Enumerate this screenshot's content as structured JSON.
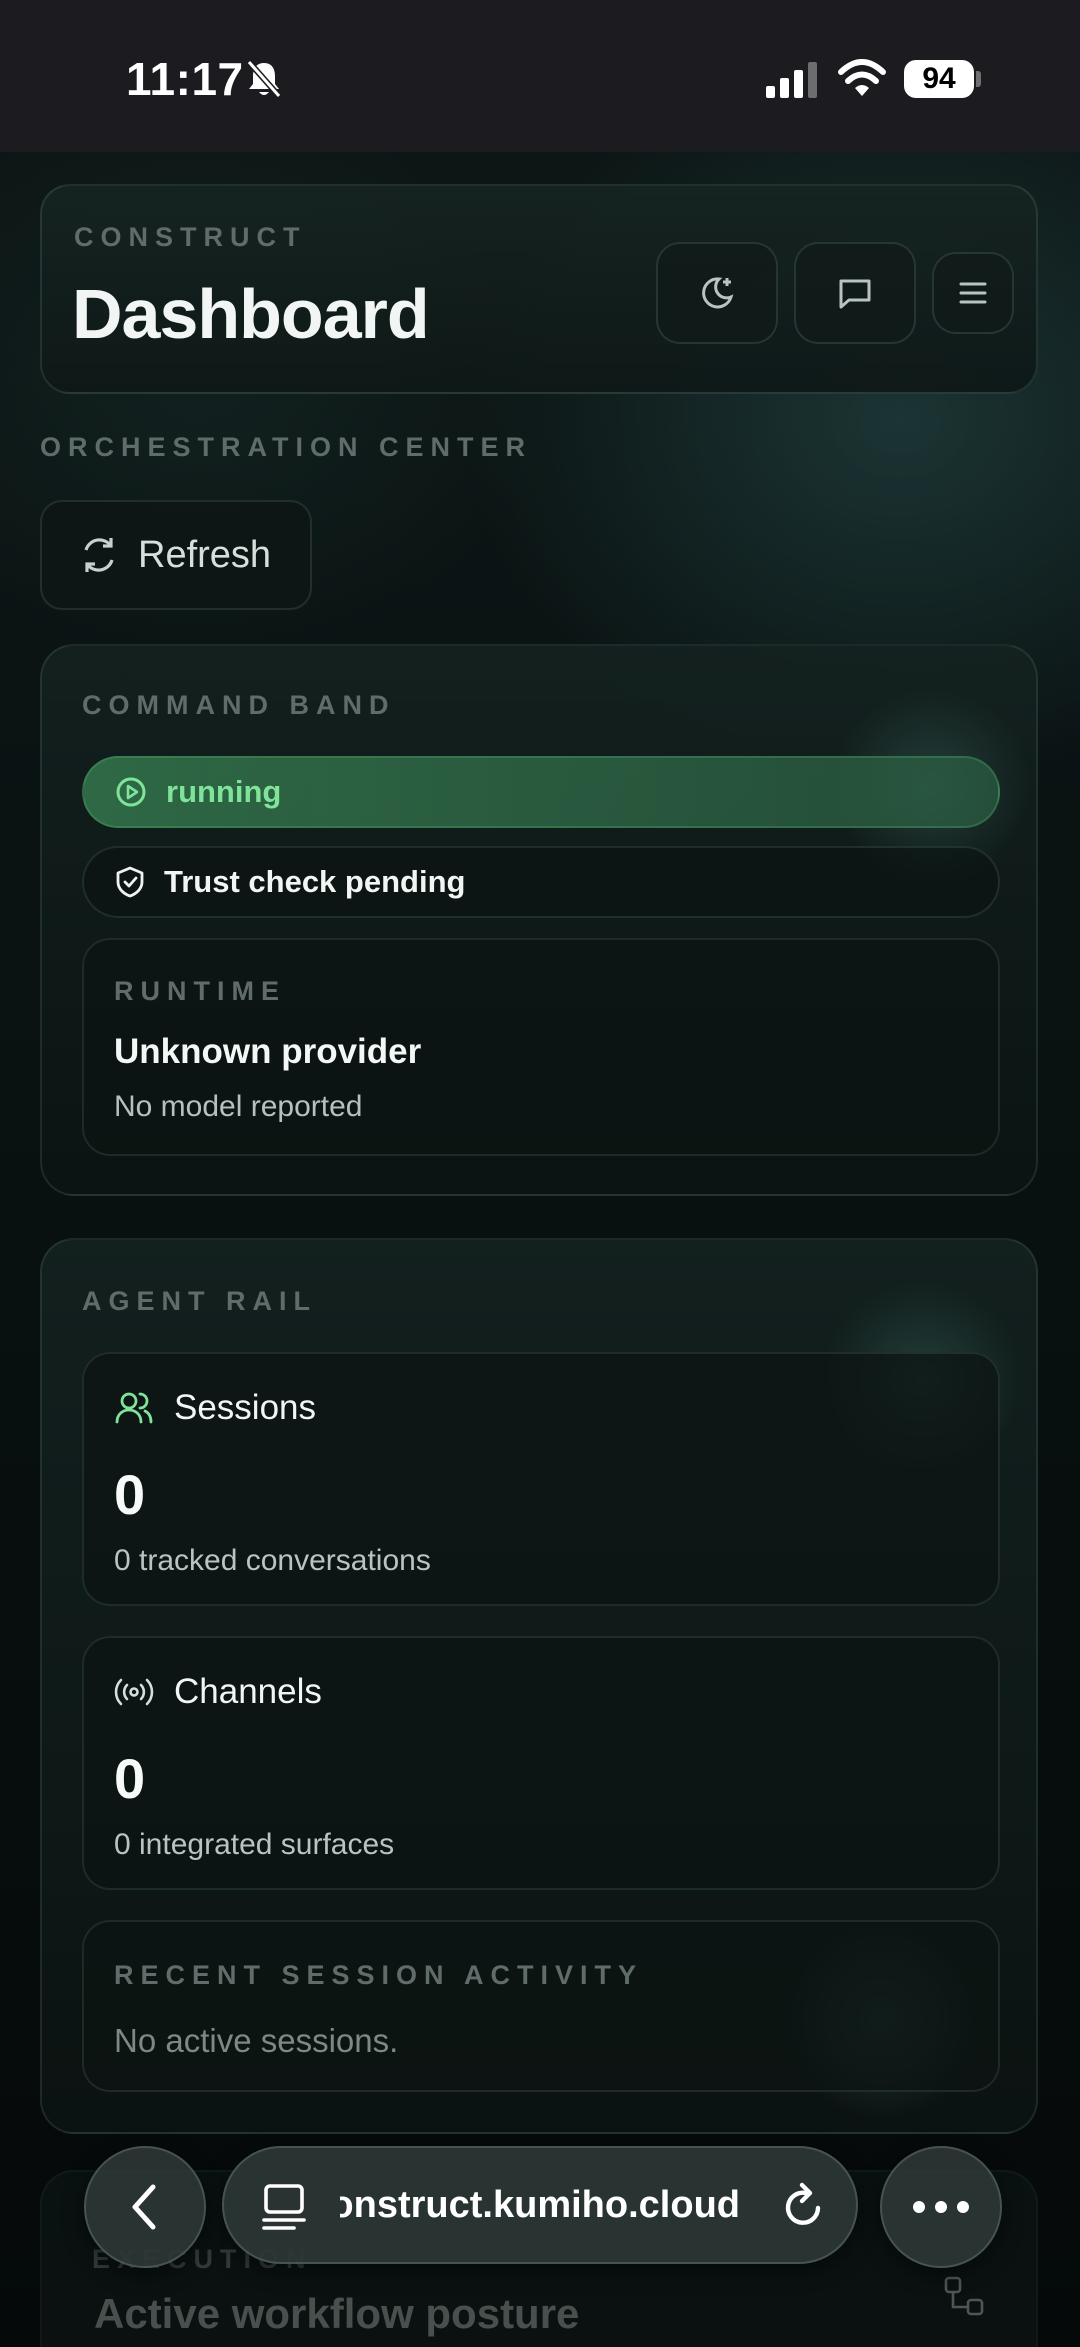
{
  "status_bar": {
    "time": "11:17",
    "battery": "94"
  },
  "header": {
    "eyebrow": "CONSTRUCT",
    "title": "Dashboard",
    "buttons": [
      "theme-toggle",
      "chat",
      "menu"
    ]
  },
  "section": {
    "eyebrow": "ORCHESTRATION CENTER",
    "refresh_label": "Refresh"
  },
  "command_band": {
    "eyebrow": "COMMAND BAND",
    "status": "running",
    "trust": "Trust check pending",
    "runtime": {
      "eyebrow": "RUNTIME",
      "provider": "Unknown provider",
      "model": "No model reported"
    }
  },
  "agent_rail": {
    "eyebrow": "AGENT RAIL",
    "sessions": {
      "label": "Sessions",
      "value": "0",
      "sub": "0 tracked conversations"
    },
    "channels": {
      "label": "Channels",
      "value": "0",
      "sub": "0 integrated surfaces"
    },
    "recent": {
      "eyebrow": "RECENT SESSION ACTIVITY",
      "empty": "No active sessions."
    }
  },
  "next_card": {
    "eyebrow": "EXECUTION",
    "title": "Active workflow posture"
  },
  "browser": {
    "url": "construct.kumiho.cloud"
  },
  "colors": {
    "accent_green": "#7fe39a",
    "background": "#070b0b"
  }
}
